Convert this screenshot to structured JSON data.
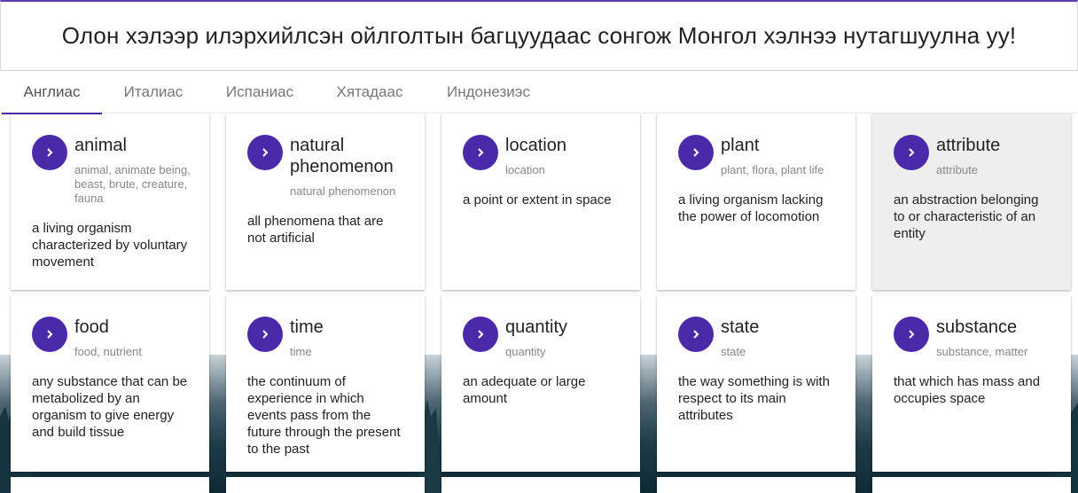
{
  "header": {
    "title": "Олон хэлээр илэрхийлсэн ойлголтын багцуудаас сонгож Монгол хэлнээ нутагшуулна уу!"
  },
  "tabs": [
    {
      "label": "Англиас",
      "active": true
    },
    {
      "label": "Италиас"
    },
    {
      "label": "Испаниас"
    },
    {
      "label": "Хятадаас"
    },
    {
      "label": "Индонезиэс"
    }
  ],
  "cards": [
    {
      "title": "animal",
      "synonyms": "animal, animate being, beast, brute, creature, fauna",
      "definition": "a living organism characterized by voluntary movement"
    },
    {
      "title": "natural phenomenon",
      "synonyms": "natural phenomenon",
      "definition": "all phenomena that are not artificial"
    },
    {
      "title": "location",
      "synonyms": "location",
      "definition": "a point or extent in space"
    },
    {
      "title": "plant",
      "synonyms": "plant, flora, plant life",
      "definition": "a living organism lacking the power of locomotion"
    },
    {
      "title": "attribute",
      "synonyms": "attribute",
      "definition": "an abstraction belonging to or characteristic of an entity"
    },
    {
      "title": "food",
      "synonyms": "food, nutrient",
      "definition": "any substance that can be metabolized by an organism to give energy and build tissue"
    },
    {
      "title": "time",
      "synonyms": "time",
      "definition": "the continuum of experience in which events pass from the future through the present to the past"
    },
    {
      "title": "quantity",
      "synonyms": "quantity",
      "definition": "an adequate or large amount"
    },
    {
      "title": "state",
      "synonyms": "state",
      "definition": "the way something is with respect to its main attributes"
    },
    {
      "title": "substance",
      "synonyms": "substance, matter",
      "definition": "that which has mass and occupies space"
    }
  ],
  "colors": {
    "accent": "#4b2aaa",
    "hover_card": "#eeeeee"
  },
  "icons": {
    "card_button": "chevron-right-icon"
  }
}
